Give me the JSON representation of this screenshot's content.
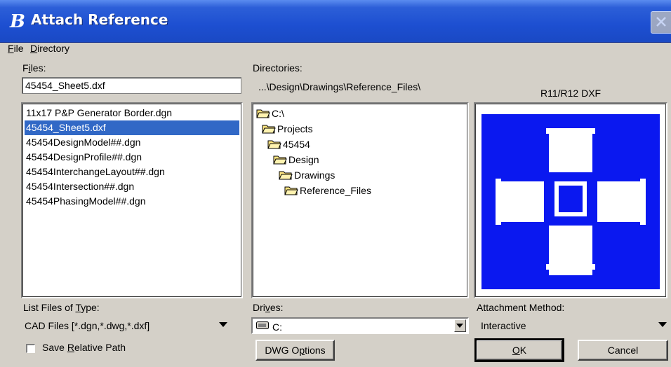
{
  "window": {
    "title": "Attach Reference",
    "app_icon": "microstation-b-icon"
  },
  "menu": [
    {
      "label": "File",
      "accel": "F",
      "rest": "ile"
    },
    {
      "label": "Directory",
      "accel": "D",
      "rest": "irectory"
    }
  ],
  "files": {
    "label_pre": "F",
    "label_accel": "i",
    "label_post": "les:",
    "filename_value": "45454_Sheet5.dxf",
    "items": [
      "11x17 P&P Generator Border.dgn",
      "45454_Sheet5.dxf",
      "45454DesignModel##.dgn",
      "45454DesignProfile##.dgn",
      "45454InterchangeLayout##.dgn",
      "45454Intersection##.dgn",
      "45454PhasingModel##.dgn"
    ],
    "selected_index": 1
  },
  "directories": {
    "label": "Directories:",
    "current_path": "...\\Design\\Drawings\\Reference_Files\\",
    "tree": [
      {
        "label": "C:\\",
        "open": true
      },
      {
        "label": "Projects",
        "open": true
      },
      {
        "label": "45454",
        "open": true
      },
      {
        "label": "Design",
        "open": true
      },
      {
        "label": "Drawings",
        "open": true
      },
      {
        "label": "Reference_Files",
        "open": true
      }
    ]
  },
  "preview": {
    "format_label": "R11/R12 DXF",
    "fill_color": "#0a18f0"
  },
  "file_type": {
    "label_pre": "List Files of ",
    "label_accel": "T",
    "label_post": "ype:",
    "value": "CAD Files [*.dgn,*.dwg,*.dxf]"
  },
  "drives": {
    "label_pre": "Dri",
    "label_accel": "v",
    "label_post": "es:",
    "value": "C:",
    "icon": "drive-icon"
  },
  "attachment": {
    "label": "Attachment Method:",
    "value": "Interactive"
  },
  "save_relative": {
    "label_pre": "Save ",
    "label_accel": "R",
    "label_post": "elative Path",
    "checked": false
  },
  "buttons": {
    "dwg_pre": "DWG O",
    "dwg_accel": "p",
    "dwg_post": "tions",
    "ok_accel": "O",
    "ok_post": "K",
    "cancel": "Cancel"
  },
  "colors": {
    "titlebar": "#1d4fd1",
    "selection": "#3168c6",
    "dialog_bg": "#d4d0c8"
  }
}
